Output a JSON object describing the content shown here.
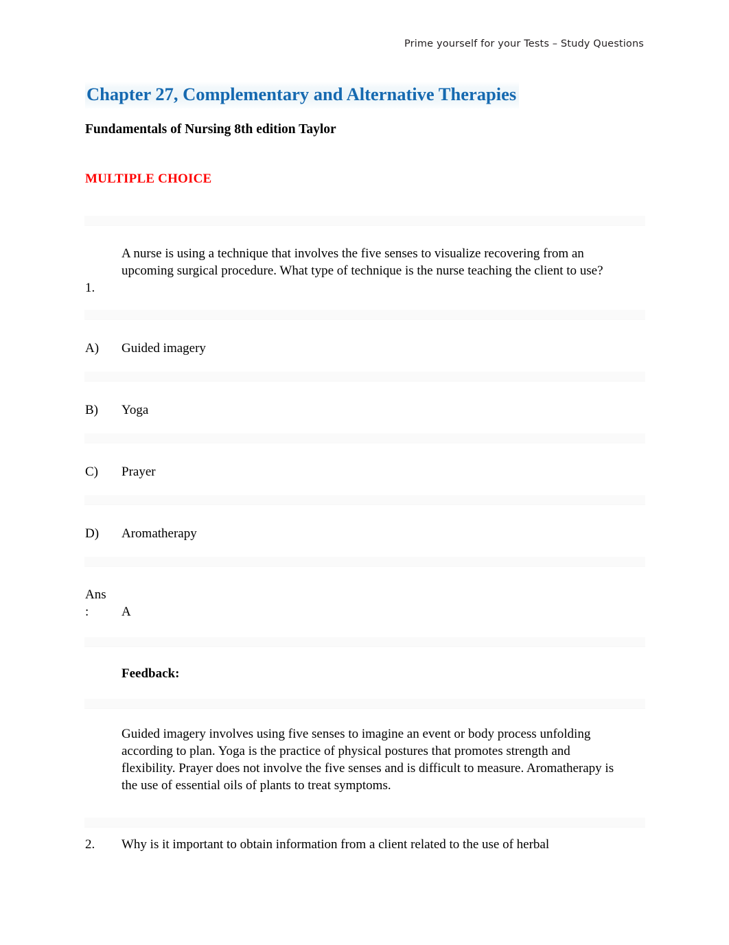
{
  "header": {
    "running_head": "Prime yourself for your Tests – Study Questions"
  },
  "title": {
    "chapter": "Chapter 27, Complementary and Alternative Therapies",
    "book": "Fundamentals of Nursing 8th edition Taylor",
    "section": "MULTIPLE CHOICE"
  },
  "colors": {
    "chapter_title": "#1569b0",
    "section_label": "#ff0000",
    "body_text": "#000000",
    "separator_band": "#fafafa",
    "page_background": "#ffffff"
  },
  "questions": [
    {
      "number": "1.",
      "text": "A nurse is using a technique that involves the five senses to visualize recovering from an upcoming surgical procedure. What type of technique is the nurse teaching the client to use?",
      "options": [
        {
          "label": "A)",
          "text": "Guided imagery"
        },
        {
          "label": "B)",
          "text": "Yoga"
        },
        {
          "label": "C)",
          "text": "Prayer"
        },
        {
          "label": "D)",
          "text": "Aromatherapy"
        }
      ],
      "answer_label": "Ans",
      "answer_colon": ":",
      "answer_value": "A",
      "feedback_label": "Feedback:",
      "feedback_text": "Guided imagery involves using five senses to imagine an event or body process unfolding according to plan. Yoga is the practice of physical postures that promotes strength and flexibility. Prayer does not involve the five senses and is difficult to measure. Aromatherapy is the use of essential oils of plants to treat symptoms."
    },
    {
      "number": "2.",
      "text": "Why is it important to obtain information from a client related to the use of herbal"
    }
  ]
}
